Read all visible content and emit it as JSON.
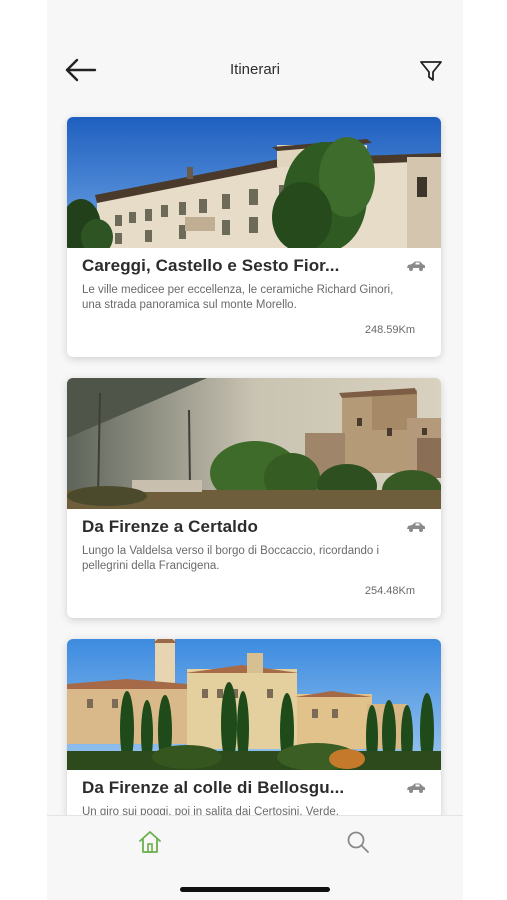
{
  "header": {
    "title": "Itinerari"
  },
  "itineraries": [
    {
      "title": "Careggi, Castello e Sesto Fior...",
      "description": "Le ville medicee per eccellenza, le ceramiche Richard Ginori, una strada panoramica sul monte Morello.",
      "distance": "248.59Km",
      "transport_icon": "car-icon"
    },
    {
      "title": "Da Firenze a Certaldo",
      "description": "Lungo la Valdelsa verso il borgo di Boccaccio, ricordando i pellegrini della Francigena.",
      "distance": "254.48Km",
      "transport_icon": "car-icon"
    },
    {
      "title": "Da Firenze al colle di Bellosgu...",
      "description": "Un giro sui poggi, poi in salita dai Certosini. Verde,",
      "distance": "",
      "transport_icon": "car-icon"
    }
  ],
  "tabbar": {
    "active_tab": "home",
    "active_color": "#6ab04c",
    "inactive_color": "#8a8a8a",
    "tabs": [
      "home-icon",
      "search-icon"
    ]
  }
}
